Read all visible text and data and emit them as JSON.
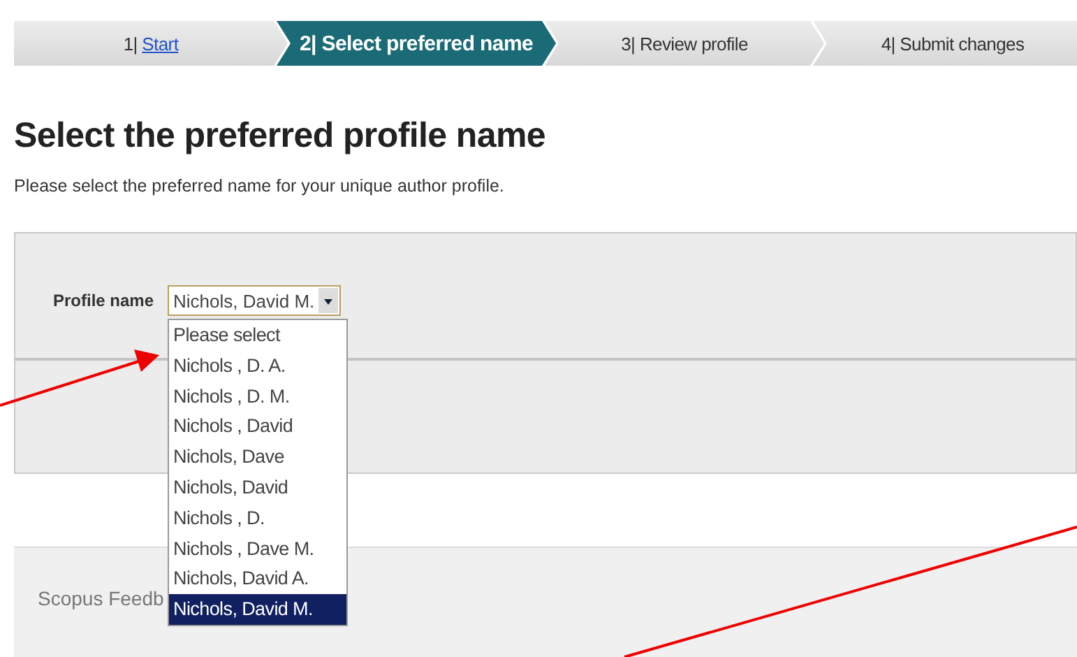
{
  "steps": [
    {
      "number": "1",
      "separator": "|",
      "label": "Start",
      "link": true,
      "selected": false
    },
    {
      "number": "2",
      "separator": "|",
      "label": "Select preferred name",
      "link": false,
      "selected": true
    },
    {
      "number": "3",
      "separator": "|",
      "label": "Review profile",
      "link": false,
      "selected": false
    },
    {
      "number": "4",
      "separator": "|",
      "label": "Submit changes",
      "link": false,
      "selected": false
    }
  ],
  "heading": "Select the preferred profile name",
  "subtitle": "Please select the preferred name for your unique author profile.",
  "profile_field": {
    "label": "Profile name",
    "value": "Nichols, David M.",
    "expanded": true,
    "options": [
      {
        "label": "Please select",
        "selected": false
      },
      {
        "label": "Nichols , D. A.",
        "selected": false
      },
      {
        "label": "Nichols , D. M.",
        "selected": false
      },
      {
        "label": "Nichols , David",
        "selected": false
      },
      {
        "label": "Nichols, Dave",
        "selected": false
      },
      {
        "label": "Nichols, David",
        "selected": false
      },
      {
        "label": "Nichols , D.",
        "selected": false
      },
      {
        "label": "Nichols , Dave M.",
        "selected": false
      },
      {
        "label": "Nichols, David A.",
        "selected": false
      },
      {
        "label": "Nichols, David M.",
        "selected": true
      }
    ]
  },
  "footer": {
    "title": "Scopus Feedb"
  }
}
